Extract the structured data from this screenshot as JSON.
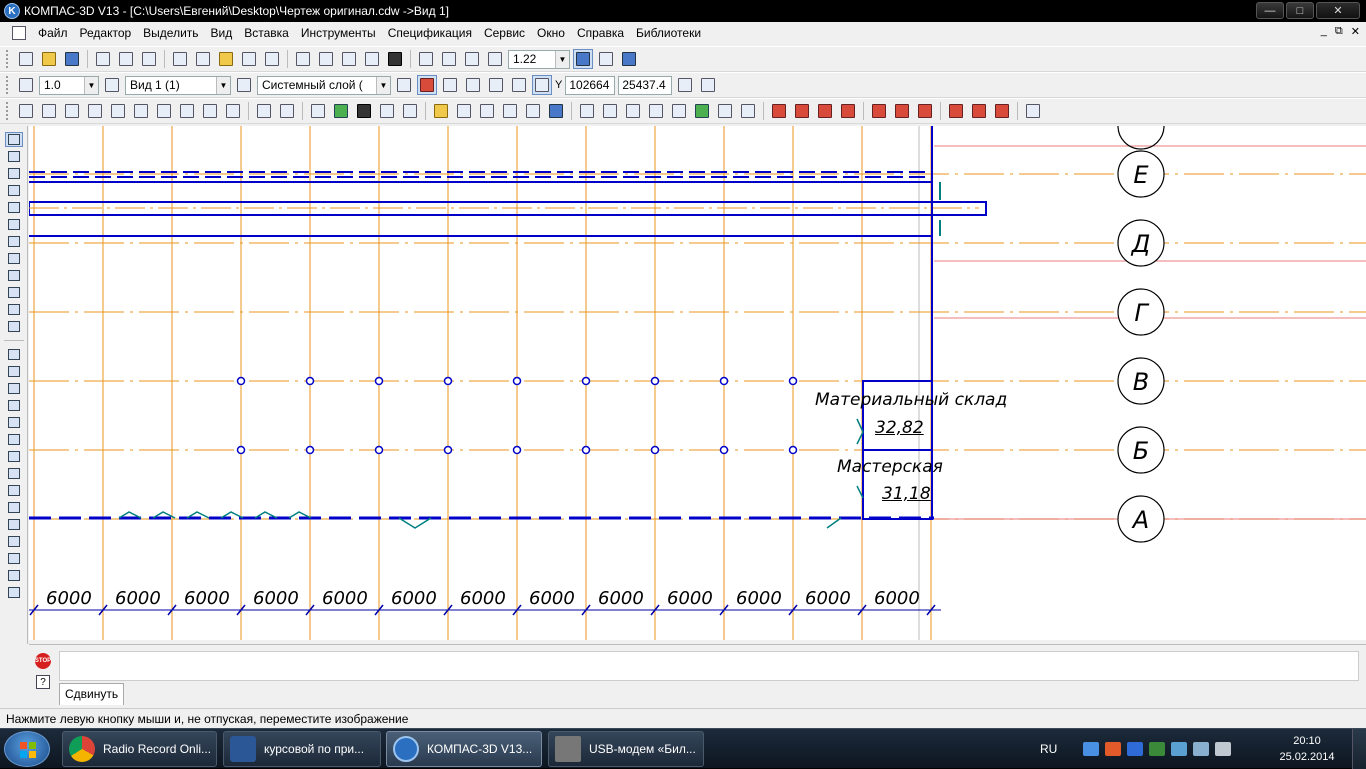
{
  "window": {
    "title": "КОМПАС-3D V13 - [C:\\Users\\Евгений\\Desktop\\Чертеж оригинал.cdw ->Вид 1]",
    "buttons": {
      "minimize": "—",
      "maximize": "□",
      "close": "✕"
    }
  },
  "menu": {
    "items": [
      "Файл",
      "Редактор",
      "Выделить",
      "Вид",
      "Вставка",
      "Инструменты",
      "Спецификация",
      "Сервис",
      "Окно",
      "Справка",
      "Библиотеки"
    ],
    "mdi_buttons": [
      "_",
      "⧉",
      "✕"
    ]
  },
  "toolbar_standard": {
    "zoom_value": "1.22"
  },
  "toolbar_current_state": {
    "step_value": "1.0",
    "view_value": "Вид 1 (1)",
    "layer_value": "Системный слой (",
    "coord_x": "102664",
    "coord_y": "25437.4",
    "coord_label": "Y"
  },
  "drawing": {
    "axis_labels": [
      "Е",
      "Д",
      "Г",
      "В",
      "Б",
      "А"
    ],
    "rooms": [
      {
        "name": "Материальный склад",
        "area": "32,82"
      },
      {
        "name": "Мастерская",
        "area": "31,18"
      }
    ],
    "dimensions": [
      "6000",
      "6000",
      "6000",
      "6000",
      "6000",
      "6000",
      "6000",
      "6000",
      "6000",
      "6000",
      "6000",
      "6000",
      "6000"
    ],
    "colors": {
      "grid_lines": "#e8961e",
      "axis_lines_red": "#e05050",
      "walls": "#0000c8",
      "openings": "#008080",
      "dim_lines": "#0000aa"
    }
  },
  "command_panel": {
    "tab_label": "Сдвинуть"
  },
  "status": {
    "text": "Нажмите левую кнопку мыши и, не отпуская, переместите изображение"
  },
  "taskbar": {
    "tasks": [
      {
        "label": "Radio Record Onli...",
        "icon": "chrome-icon"
      },
      {
        "label": "курсовой по при...",
        "icon": "word-icon"
      },
      {
        "label": "КОМПАС-3D V13...",
        "icon": "kompas-icon"
      },
      {
        "label": "USB-модем «Бил...",
        "icon": "modem-icon"
      }
    ],
    "language": "RU",
    "time": "20:10",
    "date": "25.02.2014"
  }
}
